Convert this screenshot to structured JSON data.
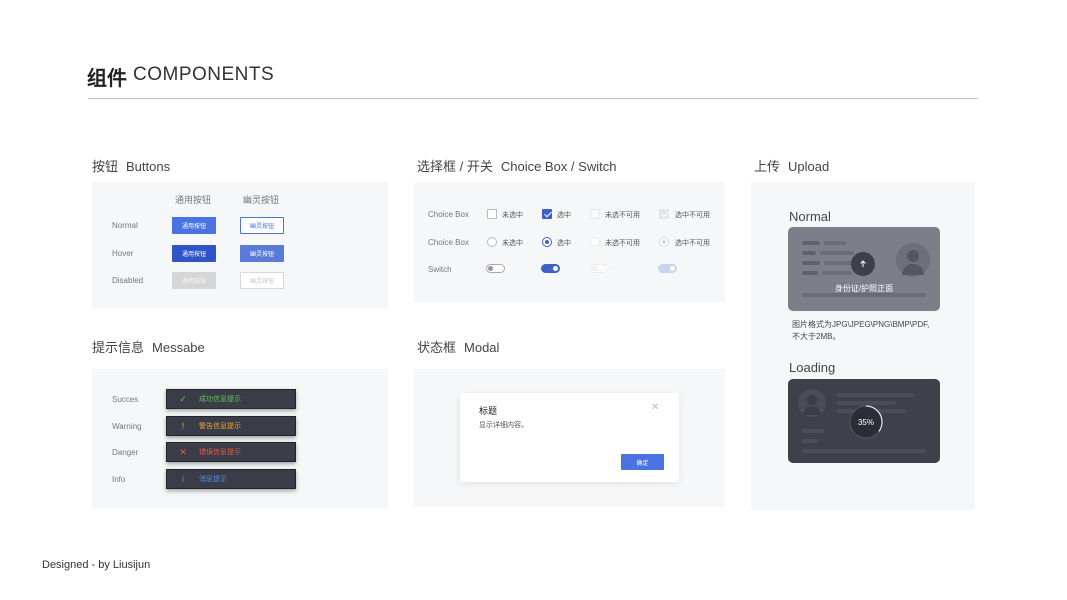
{
  "header": {
    "title_cn": "组件",
    "title_en": "COMPONENTS"
  },
  "buttons": {
    "heading_cn": "按钮",
    "heading_en": "Buttons",
    "col_common": "通用按钮",
    "col_ghost": "幽灵按钮",
    "rows": [
      {
        "label": "Normal",
        "primary": "通用按钮",
        "ghost": "幽灵按钮"
      },
      {
        "label": "Hover",
        "primary": "通用按钮",
        "ghost": "幽灵按钮"
      },
      {
        "label": "Disabled",
        "primary": "通用按钮",
        "ghost": "幽灵按钮"
      }
    ]
  },
  "choice": {
    "heading_cn": "选择框 / 开关",
    "heading_en": "Choice Box / Switch",
    "row1_label": "Choice Box",
    "row2_label": "Choice Box",
    "row3_label": "Switch",
    "unchecked": "未选中",
    "checked": "选中",
    "unchecked_disabled": "未选不可用",
    "checked_disabled": "选中不可用"
  },
  "upload": {
    "heading_cn": "上传",
    "heading_en": "Upload",
    "normal_label": "Normal",
    "card_text": "身份证/护照正面",
    "hint_line1": "图片格式为JPG\\JPEG\\PNG\\BMP\\PDF,",
    "hint_line2": "不大于2MB。",
    "loading_label": "Loading",
    "progress_text": "35%",
    "progress_value": 0.35
  },
  "messages": {
    "heading_cn": "提示信息",
    "heading_en": "Messabe",
    "items": [
      {
        "label": "Succes",
        "text": "成功信息提示",
        "icon": "✓",
        "color": "#5cc45c"
      },
      {
        "label": "Warning",
        "text": "警告信息提示",
        "icon": "!",
        "color": "#f0a030"
      },
      {
        "label": "Danger",
        "text": "错误信息提示",
        "icon": "✕",
        "color": "#e85a4a"
      },
      {
        "label": "Info",
        "text": "消息提示",
        "icon": "i",
        "color": "#4a8fe8"
      }
    ]
  },
  "modal": {
    "heading_cn": "状态框",
    "heading_en": "Modal",
    "title": "标题",
    "body": "显示详细内容。",
    "confirm": "确定",
    "close_icon": "✕"
  },
  "footer": {
    "credit": "Designed - by Liusijun"
  }
}
